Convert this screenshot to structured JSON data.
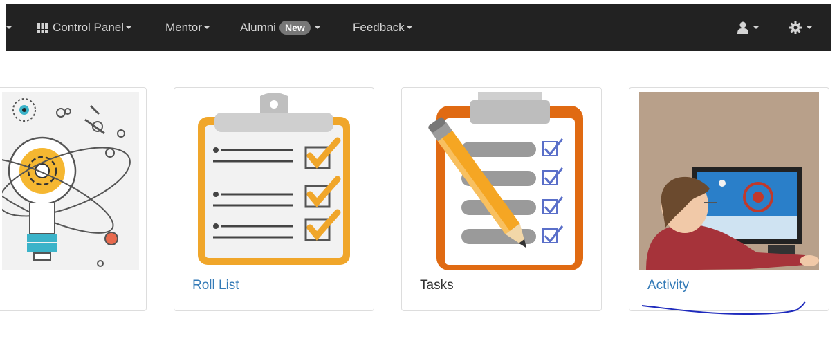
{
  "navbar": {
    "items": [
      {
        "label": "Control Panel",
        "icon": "grid-icon"
      },
      {
        "label": "Mentor"
      },
      {
        "label": "Alumni",
        "badge": "New"
      },
      {
        "label": "Feedback"
      }
    ],
    "right_icons": [
      "user-icon",
      "gear-icon"
    ]
  },
  "cards": [
    {
      "label": "",
      "image": "science-lightbulb-illustration"
    },
    {
      "label": "Roll List",
      "image": "clipboard-checklist-illustration"
    },
    {
      "label": "Tasks",
      "image": "clipboard-pencil-illustration"
    },
    {
      "label": "Activity",
      "image": "person-at-computer-illustration"
    }
  ],
  "colors": {
    "navbar_bg": "#222222",
    "link": "#337ab7",
    "badge": "#777777",
    "annotation": "#1f2bbd"
  }
}
